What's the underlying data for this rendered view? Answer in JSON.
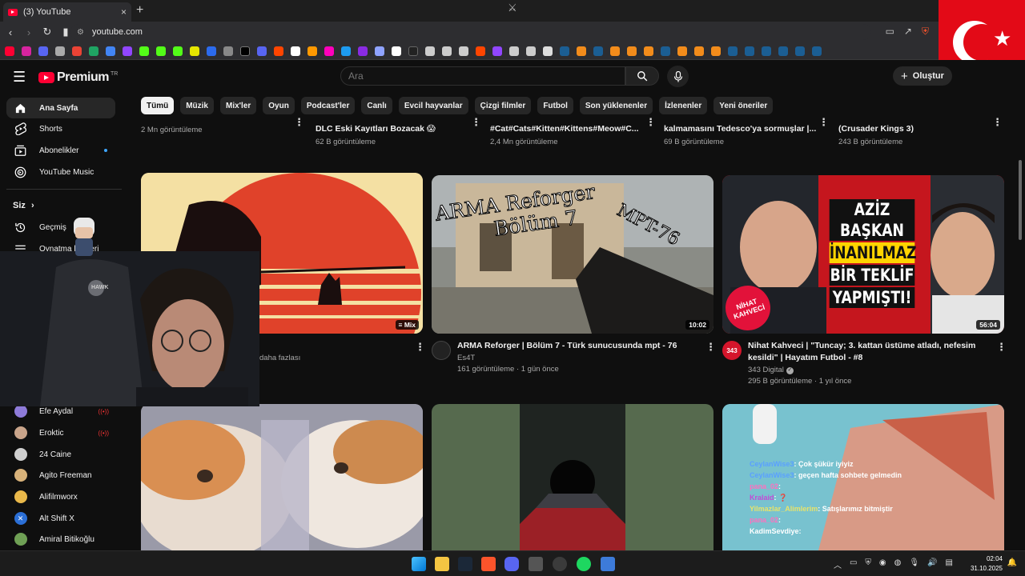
{
  "browser": {
    "tab_title": "(3) YouTube",
    "tab_close": "×",
    "new_tab": "+",
    "url": "youtube.com"
  },
  "masthead": {
    "logo_text": "Premium",
    "logo_country": "TR",
    "search_placeholder": "Ara",
    "create_label": "Oluştur"
  },
  "chips": [
    "Tümü",
    "Müzik",
    "Mix'ler",
    "Oyun",
    "Podcast'ler",
    "Canlı",
    "Evcil hayvanlar",
    "Çizgi filmler",
    "Futbol",
    "Son yüklenenler",
    "İzlenenler",
    "Yeni öneriler"
  ],
  "sidebar": {
    "main": [
      {
        "label": "Ana Sayfa",
        "icon": "home-icon"
      },
      {
        "label": "Shorts",
        "icon": "shorts-icon"
      },
      {
        "label": "Abonelikler",
        "icon": "subscriptions-icon"
      },
      {
        "label": "YouTube Music",
        "icon": "youtube-music-icon"
      }
    ],
    "you_label": "Siz",
    "you": [
      {
        "label": "Geçmiş",
        "icon": "history-icon"
      },
      {
        "label": "Oynatma listeleri",
        "icon": "playlist-icon"
      }
    ],
    "subscriptions": [
      {
        "label": "Efe Aydal",
        "color": "#8e7bd9"
      },
      {
        "label": "Eroktic",
        "color": "#c9a48a"
      },
      {
        "label": "24 Caine",
        "color": "#cfcfcf"
      },
      {
        "label": "Agito Freeman",
        "color": "#d8b27a"
      },
      {
        "label": "Alifilmworx",
        "color": "#e9b84a"
      },
      {
        "label": "Alt Shift X",
        "color": "#2b6fd6"
      },
      {
        "label": "Amiral Bitikoğlu",
        "color": "#6fa055"
      }
    ]
  },
  "top_row": [
    {
      "title": "",
      "meta": "2 Mn görüntüleme"
    },
    {
      "title": "DLC Eski Kayıtları Bozacak 😱",
      "meta": "62 B görüntüleme"
    },
    {
      "title": "#Cat#Cats#Kitten#Kittens#Meow#C...",
      "meta": "2,4 Mn görüntüleme"
    },
    {
      "title": "kalmamasını Tedesco'ya sormuşlar |...",
      "meta": "69 B görüntüleme"
    },
    {
      "title": "(Crusader Kings 3)",
      "meta": "243 B görüntüleme"
    }
  ],
  "videos": [
    {
      "title": "",
      "channel": "",
      "meta": "daha fazlası",
      "badge": "Mix"
    },
    {
      "title": "ARMA Reforger | Bölüm 7 - Türk sunucusunda mpt - 76",
      "channel": "Es4T",
      "meta": "161 görüntüleme · 1 gün önce",
      "duration": "10:02",
      "thumb_line1": "ARMA Reforger",
      "thumb_line2": "Bölüm 7",
      "thumb_line3": "MPT-76"
    },
    {
      "title_line1": "Nihat Kahveci | \"Tuncay; 3. kattan üstüme atladı, nefesim",
      "title_line2": "kesildi\" | Hayatım Futbol - #8",
      "channel": "343 Digital",
      "meta": "295 B görüntüleme · 1 yıl önce",
      "duration": "56:04",
      "thumb_l1": "AZİZ BAŞKAN",
      "thumb_l2": "İNANILMAZ",
      "thumb_l3": "BİR TEKLİF",
      "thumb_l4": "YAPMIŞTI!",
      "thumb_badge": "NİHAT KAHVECİ",
      "avatar_text": "343"
    }
  ],
  "chat_overlay": [
    {
      "user": "CeylanWise3",
      "msg": ": Çok şükür iyiyiz"
    },
    {
      "user": "CeylanWise3",
      "msg": ": geçen hafta sohbete gelmedin"
    },
    {
      "user": "pana_02",
      "msg": ":"
    },
    {
      "user": "Kralaid",
      "msg": ": ❓"
    },
    {
      "user": "Yilmazlar_Alimlerim",
      "msg": ": Satışlarımız bitmiştir"
    },
    {
      "user": "pana_02",
      "msg": ":"
    },
    {
      "user": "KadimSevdiye",
      "msg": ":"
    }
  ],
  "webcam": {
    "chair_brand": "HAWK"
  },
  "taskbar": {
    "time": "02:04",
    "date": "31.10.2025"
  },
  "colors": {
    "accent": "#ff0033",
    "background": "#0f0f0f",
    "chip_bg": "#272727",
    "verified": "#aaaaaa"
  }
}
